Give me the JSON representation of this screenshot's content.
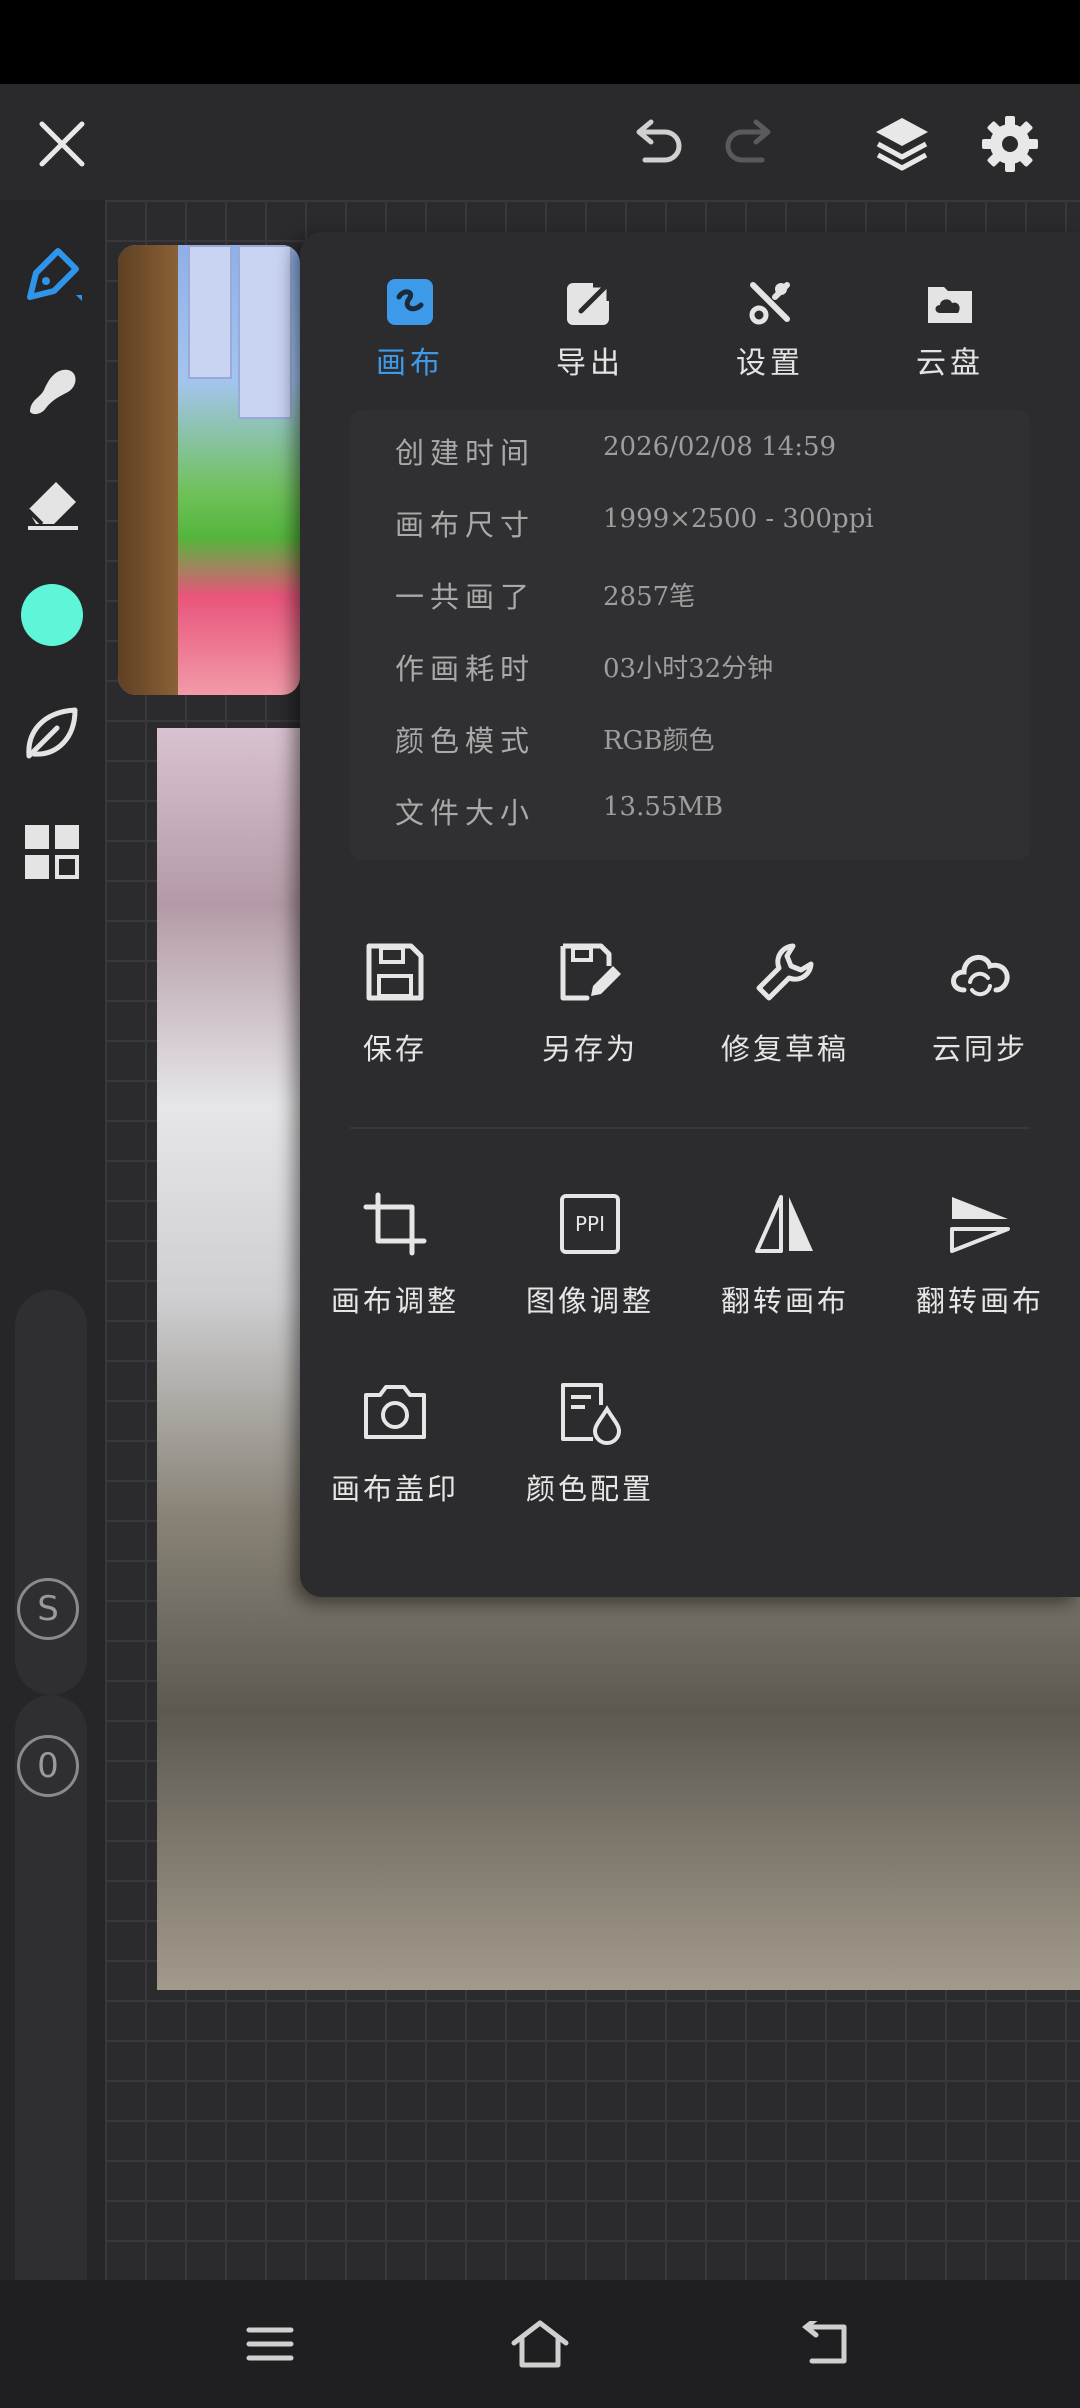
{
  "top_bar": {
    "close_icon": "close-icon",
    "undo_icon": "undo-icon",
    "redo_icon": "redo-icon",
    "layers_icon": "layers-icon",
    "settings_icon": "gear-icon"
  },
  "toolbar": {
    "tools": [
      "brush",
      "smudge",
      "eraser",
      "color",
      "leaf",
      "grid"
    ],
    "color_value": "#5ff5d8",
    "slider_size_label": "S",
    "slider_opacity_label": "0"
  },
  "panel": {
    "tabs": [
      {
        "label": "画布",
        "icon": "canvas-icon",
        "active": true
      },
      {
        "label": "导出",
        "icon": "export-icon",
        "active": false
      },
      {
        "label": "设置",
        "icon": "tools-icon",
        "active": false
      },
      {
        "label": "云盘",
        "icon": "cloud-drive-icon",
        "active": false
      }
    ],
    "info": [
      {
        "key": "创建时间",
        "value": "2026/02/08 14:59"
      },
      {
        "key": "画布尺寸",
        "value": "1999×2500 - 300ppi"
      },
      {
        "key": "一共画了",
        "value": "2857笔"
      },
      {
        "key": "作画耗时",
        "value": "03小时32分钟"
      },
      {
        "key": "颜色模式",
        "value": "RGB颜色"
      },
      {
        "key": "文件大小",
        "value": "13.55MB"
      }
    ],
    "actions_row1": [
      {
        "label": "保存",
        "icon": "save-icon"
      },
      {
        "label": "另存为",
        "icon": "save-as-icon"
      },
      {
        "label": "修复草稿",
        "icon": "wrench-icon"
      },
      {
        "label": "云同步",
        "icon": "cloud-sync-icon"
      }
    ],
    "actions_row2": [
      {
        "label": "画布调整",
        "icon": "crop-icon"
      },
      {
        "label": "图像调整",
        "icon": "ppi-icon",
        "icon_text": "PPI"
      },
      {
        "label": "翻转画布",
        "icon": "flip-horizontal-icon"
      },
      {
        "label": "翻转画布",
        "icon": "flip-vertical-icon"
      }
    ],
    "actions_row3": [
      {
        "label": "画布盖印",
        "icon": "camera-icon"
      },
      {
        "label": "颜色配置",
        "icon": "color-profile-icon"
      }
    ]
  },
  "nav": {
    "menu_icon": "menu-icon",
    "home_icon": "home-icon",
    "back_icon": "back-icon"
  },
  "colors": {
    "accent": "#3d9ae8",
    "panel_bg": "#2c2c2f"
  }
}
